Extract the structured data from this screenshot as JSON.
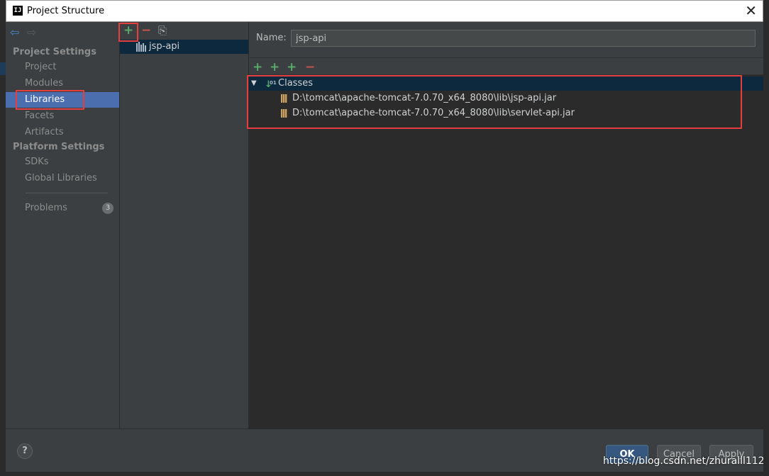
{
  "window": {
    "title": "Project Structure",
    "logo_text": "IJ"
  },
  "nav": {
    "back_icon": "back-arrow-icon",
    "forward_icon": "forward-arrow-icon"
  },
  "sidebar": {
    "project_settings_heading": "Project Settings",
    "project_items": [
      {
        "label": "Project"
      },
      {
        "label": "Modules"
      },
      {
        "label": "Libraries",
        "selected": true
      },
      {
        "label": "Facets"
      },
      {
        "label": "Artifacts"
      }
    ],
    "platform_settings_heading": "Platform Settings",
    "platform_items": [
      {
        "label": "SDKs"
      },
      {
        "label": "Global Libraries"
      }
    ],
    "problems": {
      "label": "Problems",
      "count": "3"
    }
  },
  "libraries": {
    "toolbar": {
      "add": "+",
      "remove": "−",
      "copy": "⎘"
    },
    "items": [
      {
        "name": "jsp-api",
        "selected": true
      }
    ]
  },
  "detail": {
    "name_label": "Name:",
    "name_value": "jsp-api",
    "toolbar": {
      "add": "+",
      "add_alt": "+",
      "add_specified": "+",
      "remove": "−"
    },
    "tree": {
      "root_label": "Classes",
      "children": [
        {
          "path": "D:\\tomcat\\apache-tomcat-7.0.70_x64_8080\\lib\\jsp-api.jar"
        },
        {
          "path": "D:\\tomcat\\apache-tomcat-7.0.70_x64_8080\\lib\\servlet-api.jar"
        }
      ]
    }
  },
  "footer": {
    "help": "?",
    "ok": "OK",
    "cancel": "Cancel",
    "apply": "Apply"
  },
  "watermark": "https://blog.csdn.net/zhuralll112",
  "colors": {
    "selection": "#4b6eaf",
    "accent_red": "#e53e3e",
    "add_green": "#59a869",
    "remove_red": "#c75450"
  }
}
